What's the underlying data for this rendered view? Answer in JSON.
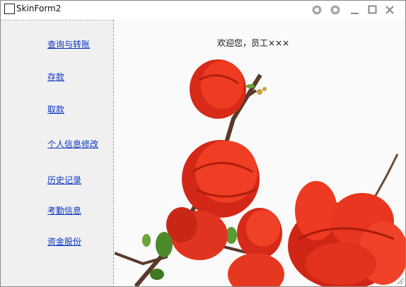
{
  "window": {
    "title": "SkinForm2"
  },
  "sidebar": {
    "items": [
      {
        "label": "查询与转账"
      },
      {
        "label": "存款"
      },
      {
        "label": "取款"
      },
      {
        "label": "个人信息修改"
      },
      {
        "label": "历史记录"
      },
      {
        "label": "考勤信息"
      },
      {
        "label": "资金股份"
      }
    ]
  },
  "main": {
    "welcome_text": "欢迎您，员工×××"
  },
  "colors": {
    "link": "#0a35c0",
    "sidebar_bg": "#f0f0f0",
    "flower": "#e8321c"
  },
  "icons": [
    "app-icon",
    "skin-icon",
    "minimize-icon",
    "maximize-icon",
    "close-icon",
    "resize-grip-icon"
  ]
}
